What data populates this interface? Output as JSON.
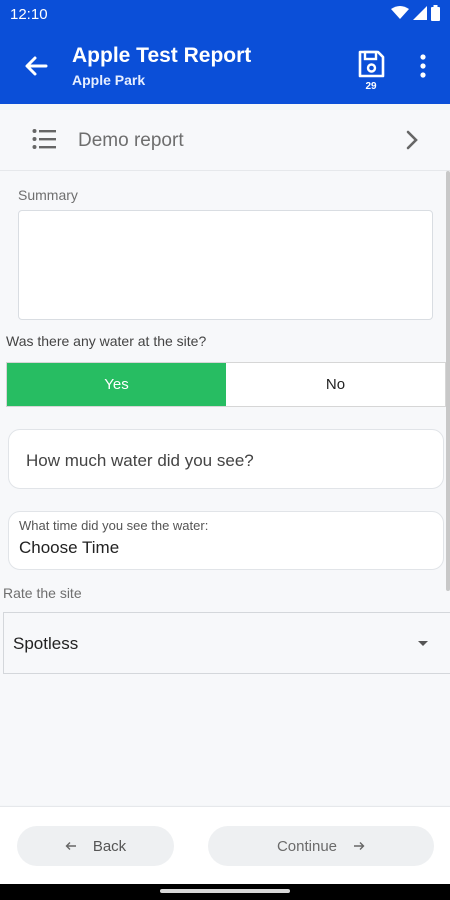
{
  "status_bar": {
    "time": "12:10"
  },
  "app_bar": {
    "title": "Apple Test Report",
    "subtitle": "Apple Park",
    "save_count": "29"
  },
  "section": {
    "label": "Demo report"
  },
  "form": {
    "summary_label": "Summary",
    "summary_value": "",
    "water_question": "Was there any water at the site?",
    "water_options": [
      "Yes",
      "No"
    ],
    "water_selected": "Yes",
    "water_amount_placeholder": "How much water did you see?",
    "time_label": "What time did you see the water:",
    "time_value": "Choose Time",
    "rate_label": "Rate the site",
    "rate_value": "Spotless"
  },
  "footer": {
    "back_label": "Back",
    "continue_label": "Continue"
  },
  "colors": {
    "primary": "#0b4fd8",
    "selected": "#27bd62"
  }
}
